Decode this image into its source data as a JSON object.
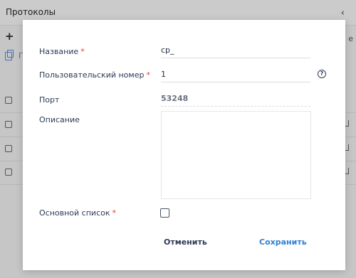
{
  "app": {
    "title": "Протоколы",
    "add_symbol": "+",
    "collapse_symbol": "‹",
    "link_letter": "П",
    "right_symbol": "e"
  },
  "modal": {
    "fields": {
      "name": {
        "label": "Название",
        "required": "*",
        "value": "cp_"
      },
      "user_number": {
        "label": "Пользовательский номер",
        "required": "*",
        "value": "1"
      },
      "port": {
        "label": "Порт",
        "value": "53248"
      },
      "description": {
        "label": "Описание",
        "value": ""
      },
      "main_list": {
        "label": "Основной список",
        "required": "*"
      }
    },
    "help_symbol": "?",
    "buttons": {
      "cancel": "Отменить",
      "save": "Сохранить"
    }
  }
}
